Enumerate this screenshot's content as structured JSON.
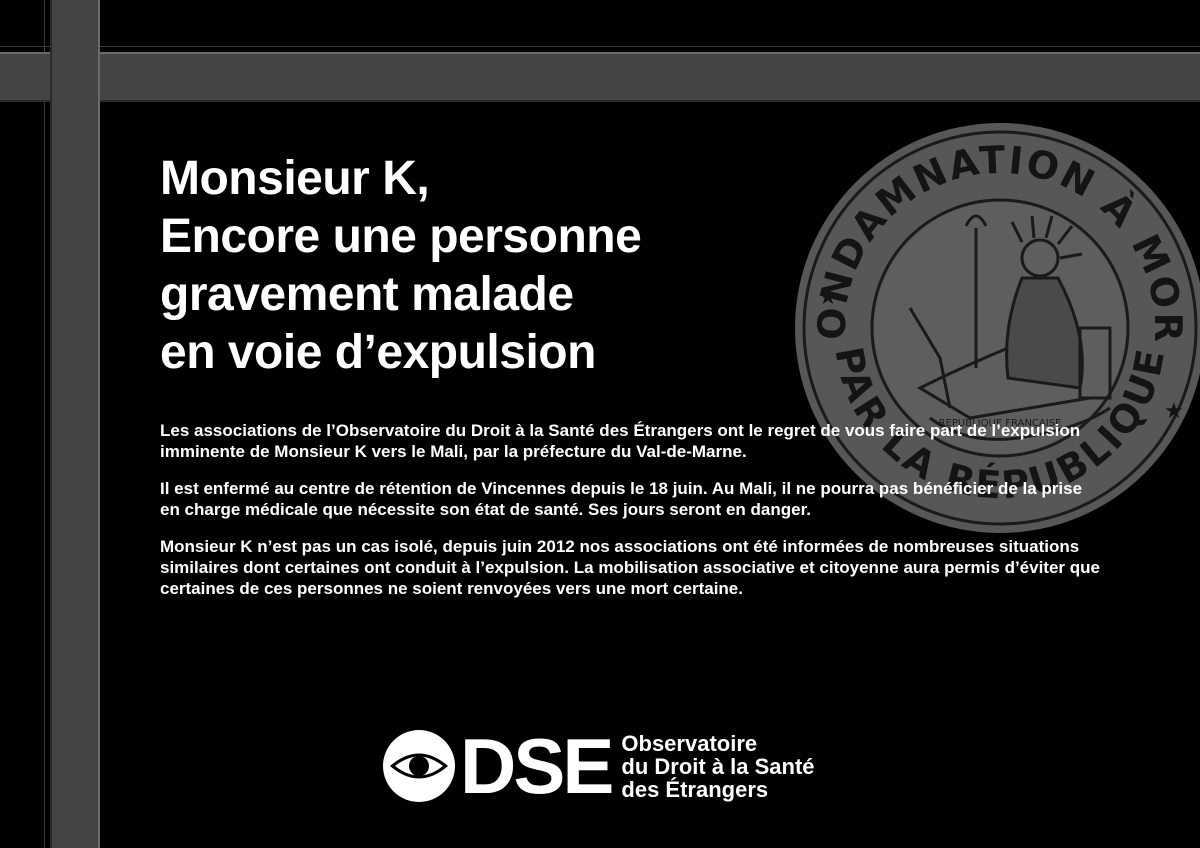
{
  "colors": {
    "background": "#000000",
    "band": "#444444",
    "seal": "#555555",
    "text": "#ffffff"
  },
  "headline": {
    "lines": [
      "Monsieur K,",
      "Encore une personne",
      "gravement malade",
      "en voie d’expulsion"
    ]
  },
  "body": {
    "paragraphs": [
      "Les associations de l’Observatoire du Droit à la Santé des Étrangers ont le regret de vous faire part de l’expulsion imminente de Monsieur K vers le Mali, par la préfecture du Val-de-Marne.",
      "Il est enfermé au centre de rétention de Vincennes depuis le 18 juin. Au Mali, il ne pourra pas bénéficier de la prise en charge médicale que nécessite son état de santé. Ses jours seront en danger.",
      "Monsieur K n’est pas un cas isolé, depuis juin 2012 nos associations ont été informées de nombreuses situations similaires dont certaines ont conduit à l’expulsion. La mobilisation associative et citoyenne aura permis d’éviter que certaines de ces personnes ne soient renvoyées vers une mort certaine."
    ]
  },
  "seal": {
    "top_text": "CONDAMNATION À MORT",
    "bottom_text": "PAR LA RÉPUBLIQUE",
    "inner_text": "REPUBLIQUE FRANÇAISE",
    "icon": "liberty-seal-icon"
  },
  "logo": {
    "letters": "DSE",
    "lines": [
      "Observatoire",
      "du Droit à la Santé",
      "des Étrangers"
    ],
    "icon": "eye-icon"
  }
}
